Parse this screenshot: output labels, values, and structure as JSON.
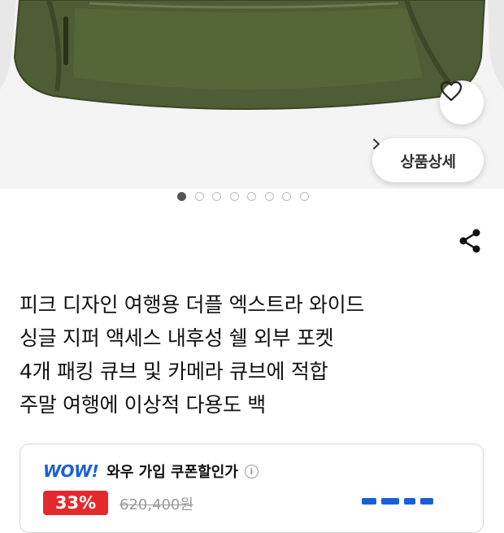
{
  "detail_button": {
    "label": "상품상세",
    "chevron": ">"
  },
  "carousel": {
    "count": 8,
    "active_index": 0
  },
  "product": {
    "title_lines": [
      "피크 디자인 여행용 더플 엑스트라 와이드",
      "싱글 지퍼 액세스 내후성 쉘 외부 포켓",
      "4개 패킹 큐브 및 카메라 큐브에 적합",
      "주말 여행에 이상적 다용도 백"
    ]
  },
  "coupon": {
    "wow_logo": "WOW!",
    "label": "와우 가입 쿠폰할인가",
    "info_icon": "i",
    "discount": "33%",
    "original_price": "620,400원"
  },
  "icons": {
    "wishlist": "heart-icon",
    "share": "share-icon",
    "chevron": "chevron-right-icon"
  },
  "colors": {
    "bag": "#4a5a30",
    "accent_blue": "#1a5fd8",
    "discount_red": "#e3292b"
  }
}
